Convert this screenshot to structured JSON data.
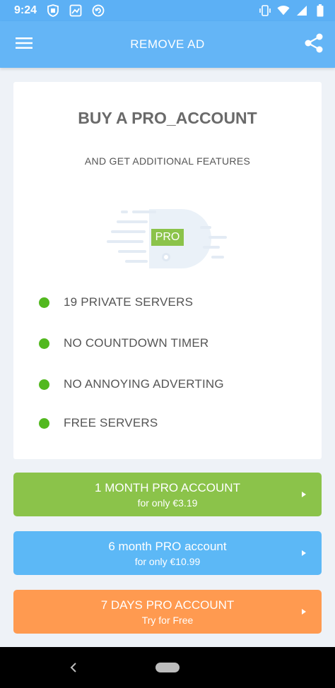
{
  "status_bar": {
    "time": "9:24",
    "left_icons": [
      "shield-icon",
      "photo-icon",
      "sync-icon"
    ],
    "right_icons": [
      "vibrate-icon",
      "wifi-icon",
      "signal-icon",
      "battery-icon"
    ]
  },
  "app_bar": {
    "title": "REMOVE AD",
    "left_icon": "menu-icon",
    "right_icon": "share-icon"
  },
  "card": {
    "title": "BUY A PRO_ACCOUNT",
    "subtitle": "AND GET ADDITIONAL FEATURES",
    "badge": "PRO",
    "features": [
      "19 PRIVATE SERVERS",
      "NO COUNTDOWN TIMER",
      "NO ANNOYING ADVERTING",
      "FREE SERVERS"
    ]
  },
  "plans": [
    {
      "title": "1 MONTH PRO ACCOUNT",
      "subtitle": "for only €3.19",
      "color": "#8bc34a"
    },
    {
      "title": "6 month PRO account",
      "subtitle": "for only €10.99",
      "color": "#5cb8f6"
    },
    {
      "title": "7 DAYS PRO ACCOUNT",
      "subtitle": "Try for Free",
      "color": "#ff9a50"
    }
  ],
  "colors": {
    "app_bar": "#64b5f6",
    "status_bar": "#5cb0f5",
    "background": "#eef2f7",
    "bullet": "#52b81f"
  }
}
